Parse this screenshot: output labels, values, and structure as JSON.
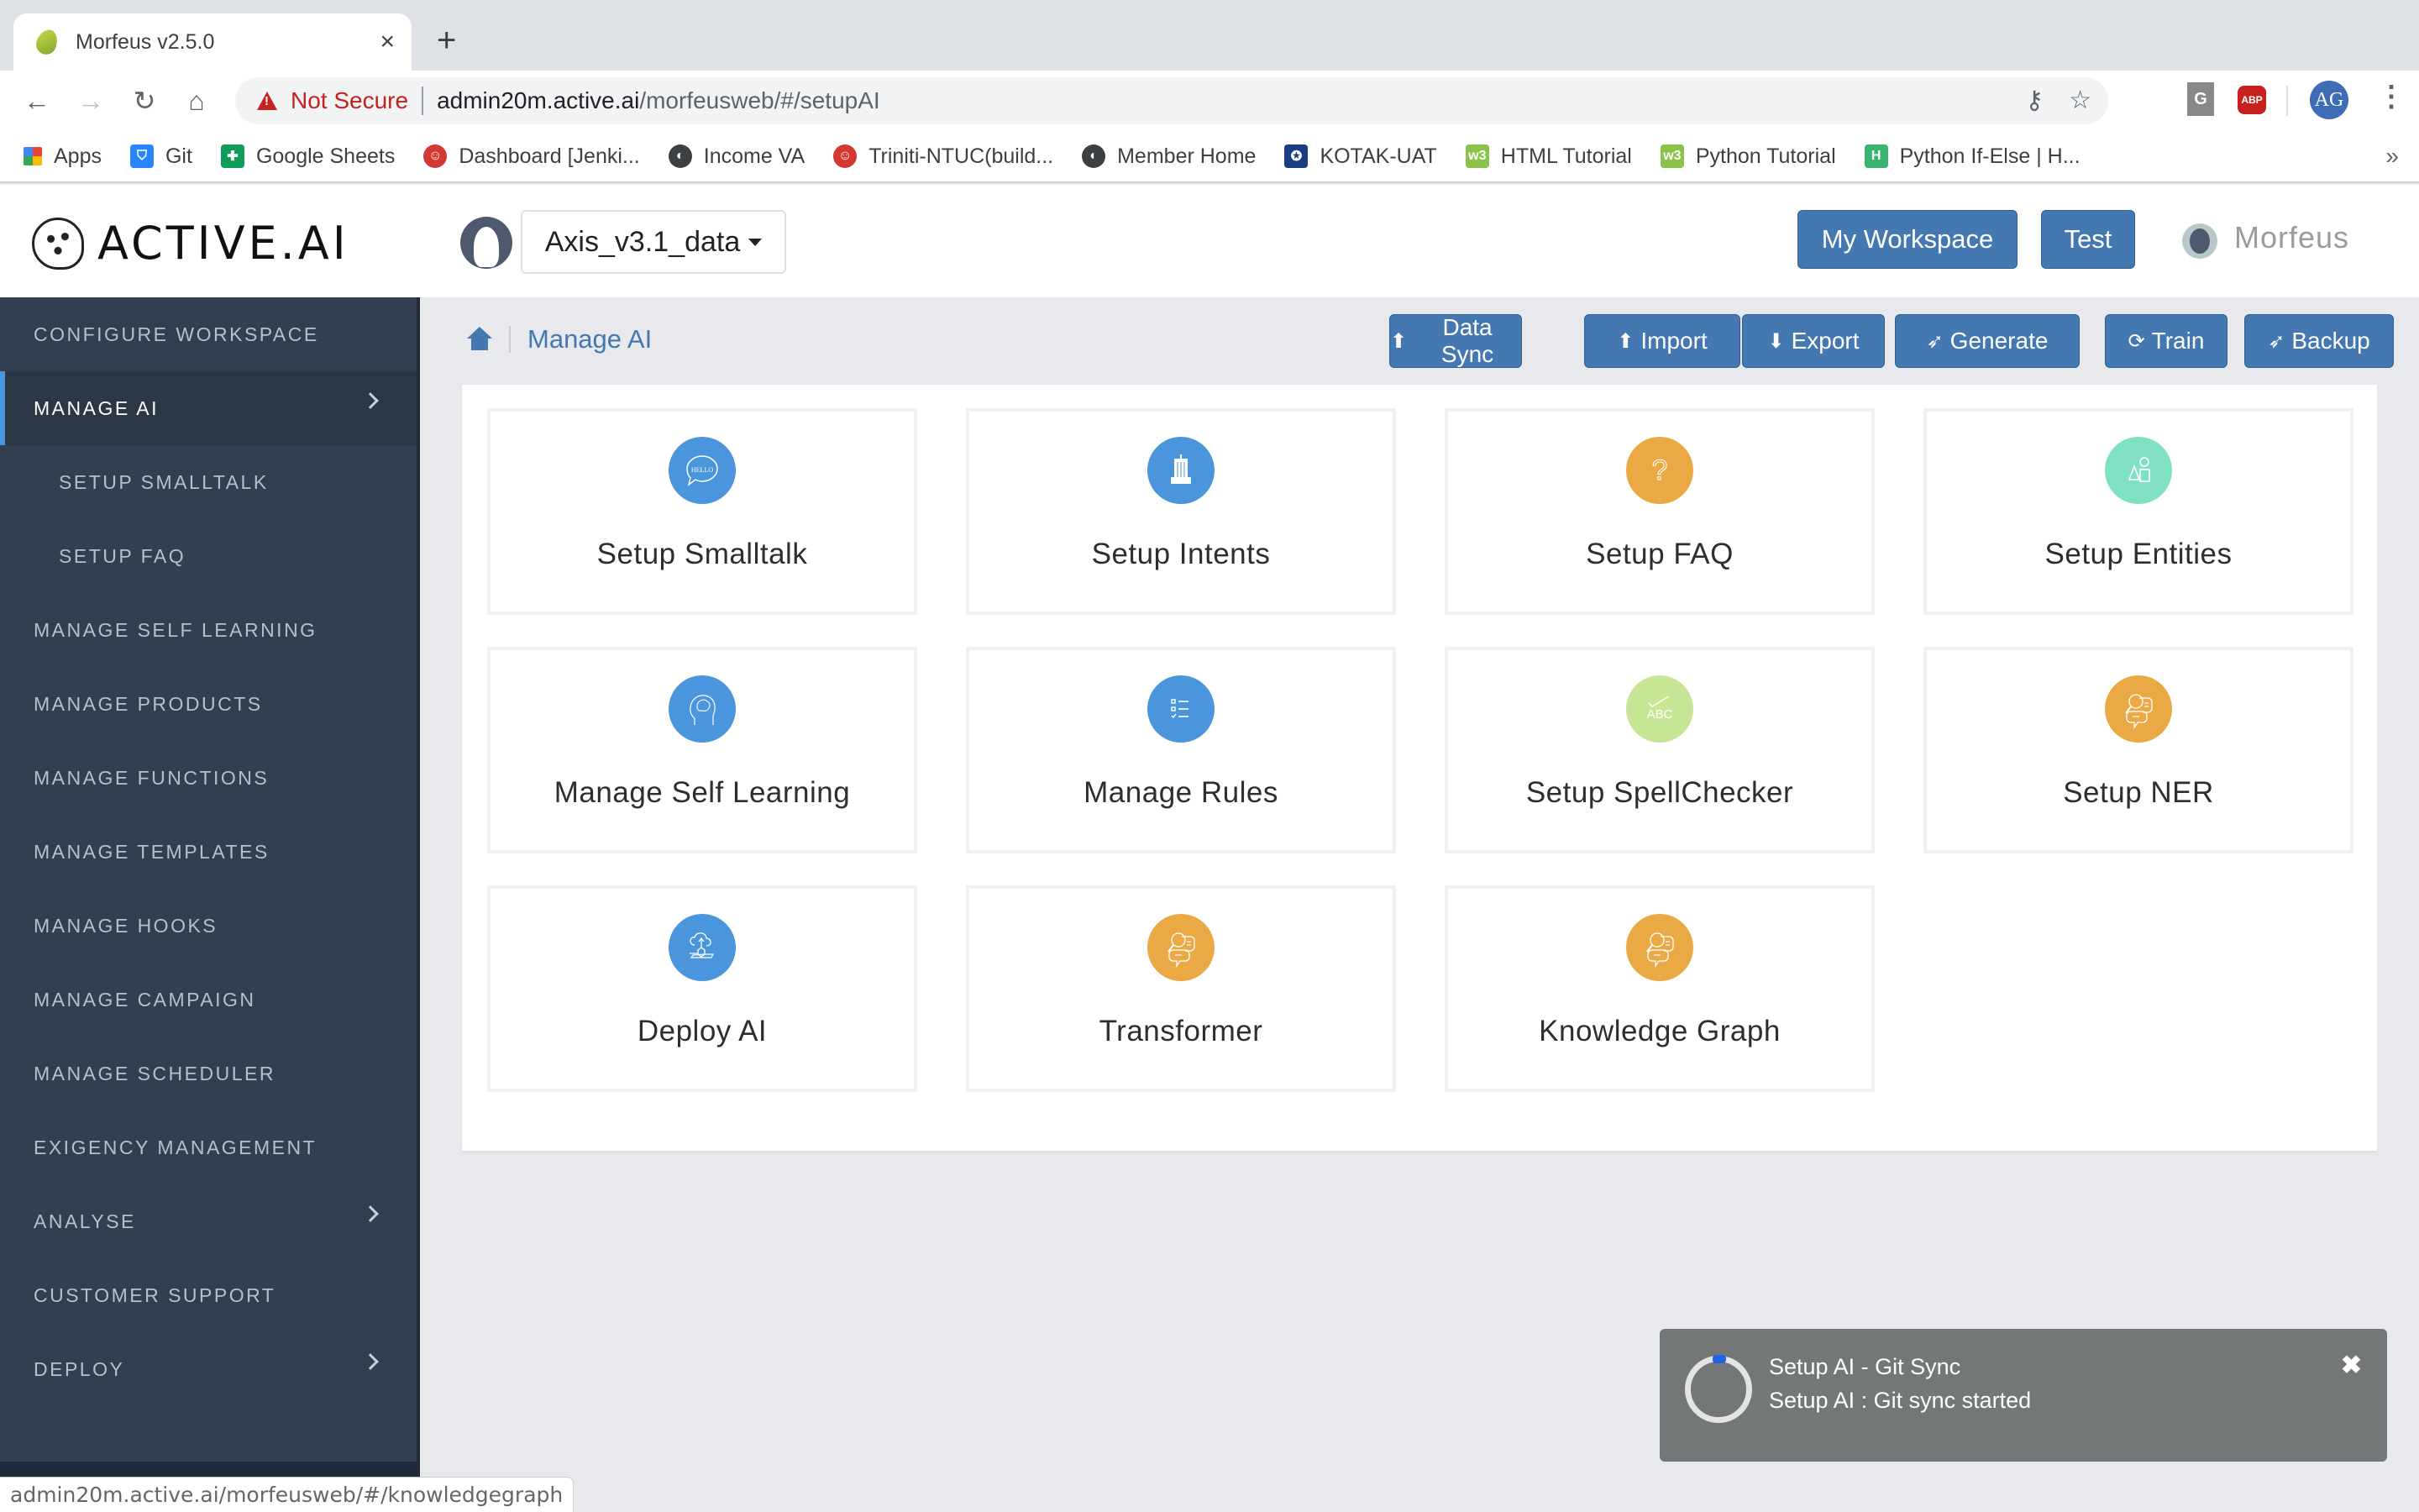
{
  "browser": {
    "tab_title": "Morfeus v2.5.0",
    "tab_close": "×",
    "new_tab": "+",
    "nav": {
      "back": "←",
      "forward": "→",
      "reload": "↻",
      "home": "⌂"
    },
    "security_label": "Not Secure",
    "url_host": "admin20m.active.ai",
    "url_path": "/morfeusweb/#/setupAI",
    "omnibox_icons": {
      "key": "⚷",
      "star": "☆"
    },
    "extensions": [
      {
        "name": "grammarly",
        "label": "G"
      },
      {
        "name": "adblock-plus",
        "label": "ABP"
      }
    ],
    "profile_initials": "AG",
    "menu": "⋮",
    "bookmarks": [
      {
        "label": "Apps",
        "icon": "apps-grid"
      },
      {
        "label": "Git",
        "icon": "bitbucket",
        "color": "#2684ff"
      },
      {
        "label": "Google Sheets",
        "icon": "sheets",
        "color": "#0f9d58"
      },
      {
        "label": "Dashboard [Jenki...",
        "icon": "jenkins",
        "color": "#d33833"
      },
      {
        "label": "Income VA",
        "icon": "globe",
        "color": "#3c4043"
      },
      {
        "label": "Triniti-NTUC(build...",
        "icon": "jenkins",
        "color": "#d33833"
      },
      {
        "label": "Member Home",
        "icon": "globe",
        "color": "#3c4043"
      },
      {
        "label": "KOTAK-UAT",
        "icon": "kotak",
        "color": "#1b3b82"
      },
      {
        "label": "HTML Tutorial",
        "icon": "w3schools",
        "color": "#8bc34a"
      },
      {
        "label": "Python Tutorial",
        "icon": "w3schools",
        "color": "#8bc34a"
      },
      {
        "label": "Python If-Else | H...",
        "icon": "hackerrank",
        "color": "#39b36f"
      }
    ],
    "bookmarks_more": "»",
    "status_url": "admin20m.active.ai/morfeusweb/#/knowledgegraph"
  },
  "header": {
    "logo_text": "ACTIVE.AI",
    "workspace": "Axis_v3.1_data",
    "my_workspace_label": "My Workspace",
    "test_label": "Test",
    "user_name": "Morfeus"
  },
  "sidebar": {
    "items": [
      {
        "label": "Configure Workspace",
        "level": 0,
        "active": false,
        "chevron": false
      },
      {
        "label": "Manage AI",
        "level": 0,
        "active": true,
        "chevron": true
      },
      {
        "label": "Setup Smalltalk",
        "level": 1,
        "active": false,
        "chevron": false
      },
      {
        "label": "Setup FAQ",
        "level": 1,
        "active": false,
        "chevron": false
      },
      {
        "label": "Manage Self Learning",
        "level": 0,
        "active": false,
        "chevron": false
      },
      {
        "label": "Manage Products",
        "level": 0,
        "active": false,
        "chevron": false
      },
      {
        "label": "Manage Functions",
        "level": 0,
        "active": false,
        "chevron": false
      },
      {
        "label": "Manage Templates",
        "level": 0,
        "active": false,
        "chevron": false
      },
      {
        "label": "Manage Hooks",
        "level": 0,
        "active": false,
        "chevron": false
      },
      {
        "label": "Manage Campaign",
        "level": 0,
        "active": false,
        "chevron": false
      },
      {
        "label": "Manage Scheduler",
        "level": 0,
        "active": false,
        "chevron": false
      },
      {
        "label": "Exigency Management",
        "level": 0,
        "active": false,
        "chevron": false
      },
      {
        "label": "Analyse",
        "level": 0,
        "active": false,
        "chevron": true
      },
      {
        "label": "Customer Support",
        "level": 0,
        "active": false,
        "chevron": false
      },
      {
        "label": "Deploy",
        "level": 0,
        "active": false,
        "chevron": true
      }
    ]
  },
  "breadcrumb": {
    "current": "Manage AI"
  },
  "actions": [
    {
      "label": "Data Sync",
      "icon": "upload"
    },
    {
      "label": "Import",
      "icon": "upload"
    },
    {
      "label": "Export",
      "icon": "download"
    },
    {
      "label": "Generate",
      "icon": "rocket"
    },
    {
      "label": "Train",
      "icon": "refresh"
    },
    {
      "label": "Backup",
      "icon": "rocket"
    }
  ],
  "cards": [
    {
      "label": "Setup Smalltalk",
      "icon": "hello-bubble",
      "color": "#4a95db"
    },
    {
      "label": "Setup Intents",
      "icon": "building",
      "color": "#4a95db"
    },
    {
      "label": "Setup FAQ",
      "icon": "question",
      "color": "#eba945"
    },
    {
      "label": "Setup Entities",
      "icon": "shapes",
      "color": "#80e0c4"
    },
    {
      "label": "Manage Self Learning",
      "icon": "brain-head",
      "color": "#4a95db"
    },
    {
      "label": "Manage Rules",
      "icon": "checklist",
      "color": "#4a95db"
    },
    {
      "label": "Setup SpellChecker",
      "icon": "abc-check",
      "color": "#c6e696"
    },
    {
      "label": "Setup NER",
      "icon": "chat-search",
      "color": "#eba945"
    },
    {
      "label": "Deploy AI",
      "icon": "cloud-deploy",
      "color": "#4a95db"
    },
    {
      "label": "Transformer",
      "icon": "chat-search",
      "color": "#eba945"
    },
    {
      "label": "Knowledge Graph",
      "icon": "chat-search",
      "color": "#eba945"
    }
  ],
  "toast": {
    "title": "Setup AI - Git Sync",
    "message": "Setup AI : Git sync started",
    "close": "✖"
  }
}
